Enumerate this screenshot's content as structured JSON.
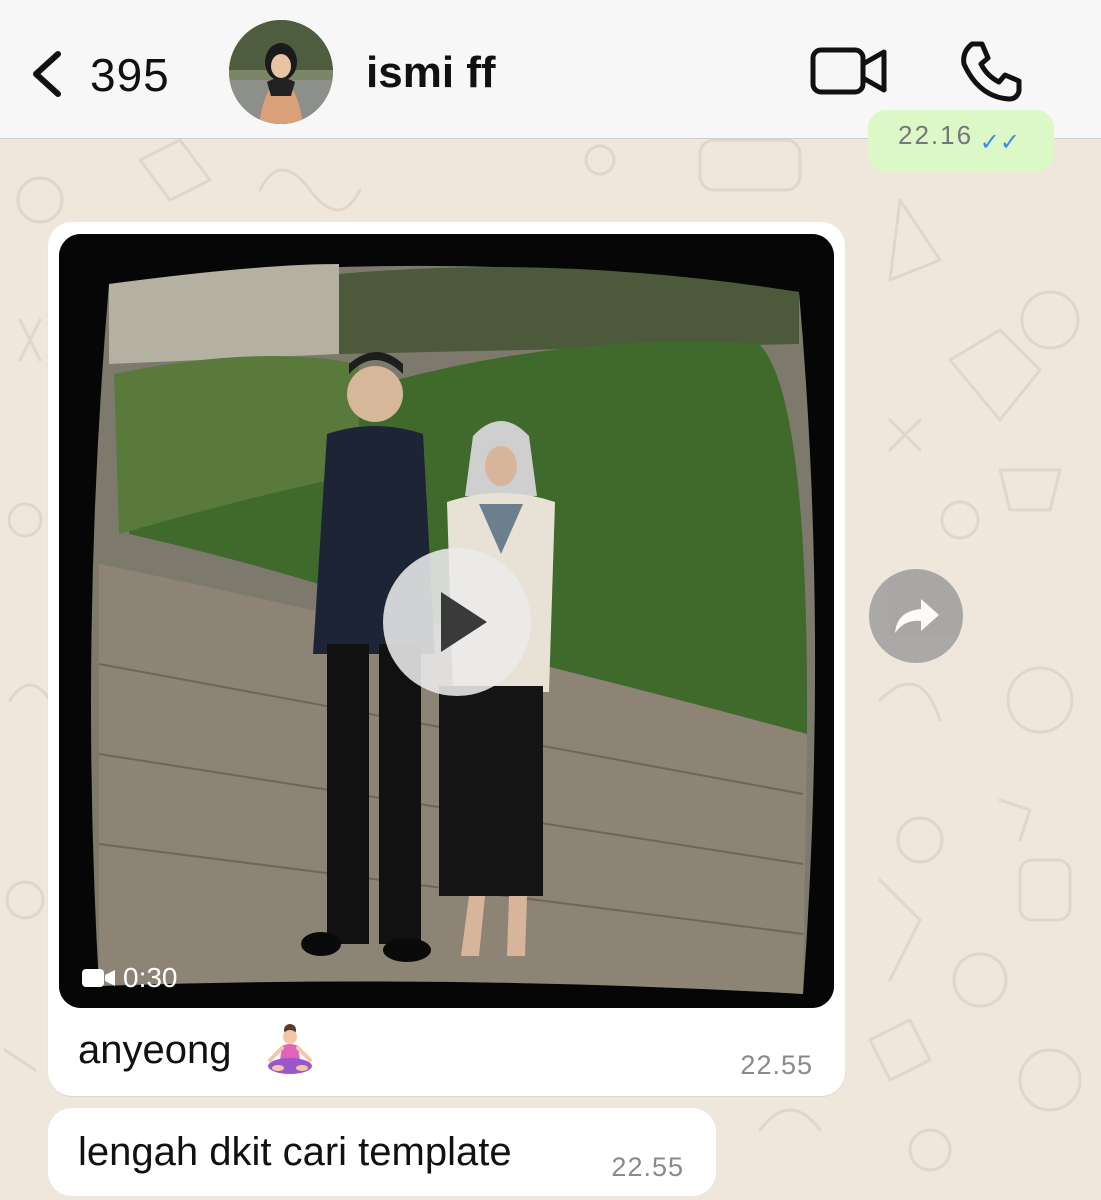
{
  "header": {
    "back_count": "395",
    "contact_name": "ismi ff",
    "icons": {
      "back": "chevron-left-icon",
      "video_call": "video-camera-icon",
      "voice_call": "phone-icon"
    }
  },
  "previous_message": {
    "time": "22.16",
    "status": "read-double-check",
    "status_color": "#3a8ee6"
  },
  "messages": [
    {
      "type": "video",
      "duration": "0:30",
      "caption": "anyeong",
      "emoji": "person-in-lotus-position-emoji",
      "time": "22.55"
    },
    {
      "type": "text",
      "text": "lengah dkit cari template",
      "time": "22.55"
    }
  ],
  "colors": {
    "chat_background": "#efe7dc",
    "incoming_bubble": "#ffffff",
    "outgoing_bubble": "#dcf8c6",
    "header_bg": "#f7f7f7"
  }
}
